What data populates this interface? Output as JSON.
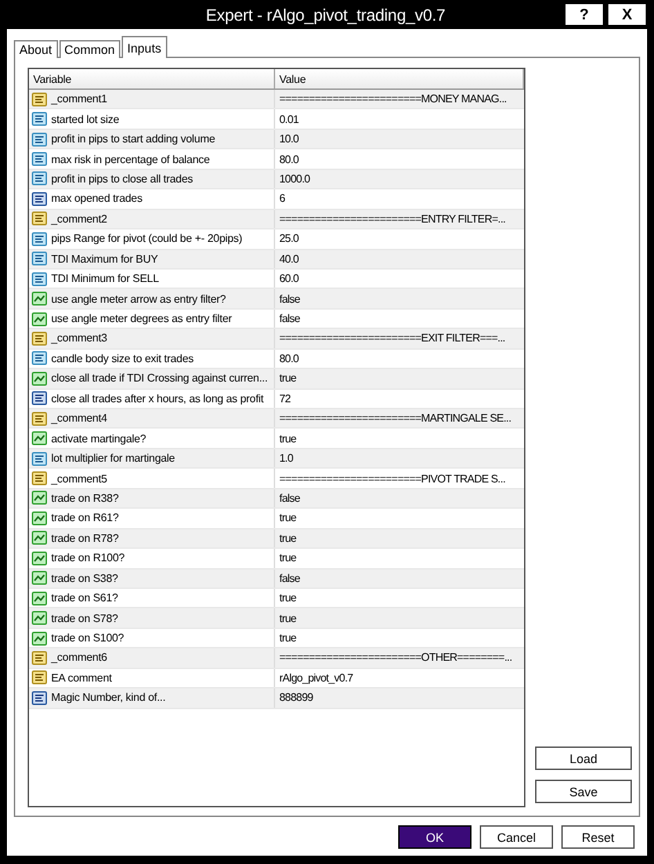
{
  "window": {
    "title": "Expert - rAlgo_pivot_trading_v0.7",
    "help": "?",
    "close": "X"
  },
  "tabs": [
    {
      "label": "About",
      "selected": false
    },
    {
      "label": "Common",
      "selected": false
    },
    {
      "label": "Inputs",
      "selected": true
    }
  ],
  "table": {
    "columns": [
      "Variable",
      "Value"
    ],
    "rows": [
      {
        "kind": "string",
        "variable": "_comment1",
        "value": "========================MONEY MANAG..."
      },
      {
        "kind": "double",
        "variable": "started lot size",
        "value": "0.01"
      },
      {
        "kind": "double",
        "variable": "profit in pips to start adding volume",
        "value": "10.0"
      },
      {
        "kind": "double",
        "variable": "max risk in percentage of balance",
        "value": "80.0"
      },
      {
        "kind": "double",
        "variable": "profit in pips to close all trades",
        "value": "1000.0"
      },
      {
        "kind": "int",
        "variable": "max opened trades",
        "value": "6"
      },
      {
        "kind": "string",
        "variable": "_comment2",
        "value": "========================ENTRY FILTER=..."
      },
      {
        "kind": "double",
        "variable": "pips Range for pivot (could be +- 20pips)",
        "value": "25.0"
      },
      {
        "kind": "double",
        "variable": "TDI Maximum for BUY",
        "value": "40.0"
      },
      {
        "kind": "double",
        "variable": "TDI Minimum for SELL",
        "value": "60.0"
      },
      {
        "kind": "bool",
        "variable": "use angle meter arrow as entry filter?",
        "value": "false"
      },
      {
        "kind": "bool",
        "variable": "use angle meter degrees as entry filter",
        "value": "false"
      },
      {
        "kind": "string",
        "variable": "_comment3",
        "value": "========================EXIT FILTER===..."
      },
      {
        "kind": "double",
        "variable": "candle body size to exit trades",
        "value": "80.0"
      },
      {
        "kind": "bool",
        "variable": "close all  trade if TDI Crossing against curren...",
        "value": "true"
      },
      {
        "kind": "int",
        "variable": "close all trades after x hours, as long as profit",
        "value": "72"
      },
      {
        "kind": "string",
        "variable": "_comment4",
        "value": "========================MARTINGALE SE..."
      },
      {
        "kind": "bool",
        "variable": "activate martingale?",
        "value": "true"
      },
      {
        "kind": "double",
        "variable": "lot multiplier for martingale",
        "value": "1.0"
      },
      {
        "kind": "string",
        "variable": "_comment5",
        "value": "========================PIVOT TRADE S..."
      },
      {
        "kind": "bool",
        "variable": "trade on R38?",
        "value": "false"
      },
      {
        "kind": "bool",
        "variable": "trade on R61?",
        "value": "true"
      },
      {
        "kind": "bool",
        "variable": "trade on R78?",
        "value": "true"
      },
      {
        "kind": "bool",
        "variable": "trade on R100?",
        "value": "true"
      },
      {
        "kind": "bool",
        "variable": "trade on S38?",
        "value": "false"
      },
      {
        "kind": "bool",
        "variable": "trade on S61?",
        "value": "true"
      },
      {
        "kind": "bool",
        "variable": "trade on S78?",
        "value": "true"
      },
      {
        "kind": "bool",
        "variable": "trade on S100?",
        "value": "true"
      },
      {
        "kind": "string",
        "variable": "_comment6",
        "value": "========================OTHER========..."
      },
      {
        "kind": "string",
        "variable": "EA comment",
        "value": "rAlgo_pivot_v0.7"
      },
      {
        "kind": "int",
        "variable": "Magic Number, kind of...",
        "value": "888899"
      }
    ]
  },
  "side_buttons": [
    "Load",
    "Save"
  ],
  "buttons": [
    {
      "label": "OK",
      "kind": "primary"
    },
    {
      "label": "Cancel",
      "kind": "normal"
    },
    {
      "label": "Reset",
      "kind": "normal"
    }
  ]
}
